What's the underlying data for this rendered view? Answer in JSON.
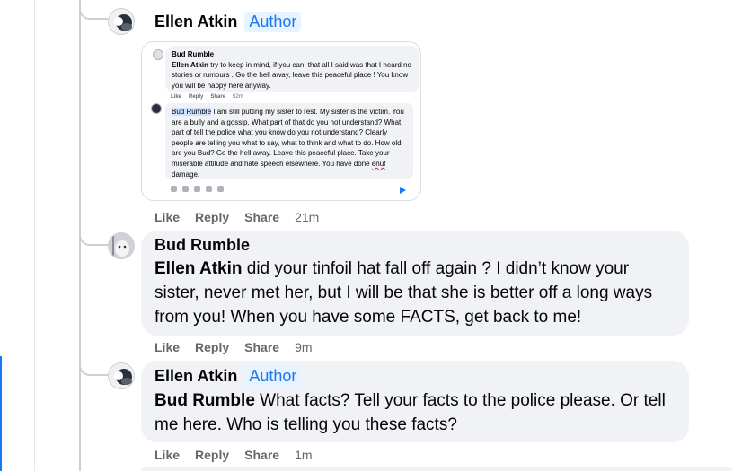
{
  "comments": [
    {
      "author": "Ellen Atkin",
      "badge": "Author",
      "actions": {
        "like": "Like",
        "reply": "Reply",
        "share": "Share",
        "time": "21m"
      },
      "screenshot": {
        "top_author": "Bud Rumble",
        "top_mention": "Ellen Atkin",
        "top_text": "try to keep in mind, if you can, that all I said was that I heard no stories or rumours . Go the hell away, leave this peaceful place ! You know you will be happy here anyway.",
        "top_actions": {
          "like": "Like",
          "reply": "Reply",
          "share": "Share",
          "time": "52m"
        },
        "reply_mention": "Bud Rumble",
        "reply_text": "I am still putting my sister to rest. My sister is the victim. You are a bully and a gossip. What part of that do you not understand? What part of tell the police what you know do you not understand? Clearly people are telling you what to say, what to think and what to do. How old are you Bud? Go the hell away. Leave this peaceful place. Take your miserable attitude and hate speech elsewhere. You have done ",
        "reply_misspelled": "enuf",
        "reply_end": " damage."
      }
    },
    {
      "author": "Bud Rumble",
      "mention": "Ellen Atkin",
      "text": " did your tinfoil hat fall off again ? I didn’t know your sister, never met her, but I will be that she is better off a long ways from you! When you have some FACTS, get back to me!",
      "actions": {
        "like": "Like",
        "reply": "Reply",
        "share": "Share",
        "time": "9m"
      }
    },
    {
      "author": "Ellen Atkin",
      "badge": "Author",
      "mention": "Bud Rumble",
      "text": " What facts? Tell your facts to the police please. Or tell me here. Who is telling you these facts?",
      "actions": {
        "like": "Like",
        "reply": "Reply",
        "share": "Share",
        "time": "1m"
      }
    }
  ],
  "colors": {
    "accent": "#1877f2",
    "bubble": "#f0f2f5",
    "meta": "#65676b"
  }
}
